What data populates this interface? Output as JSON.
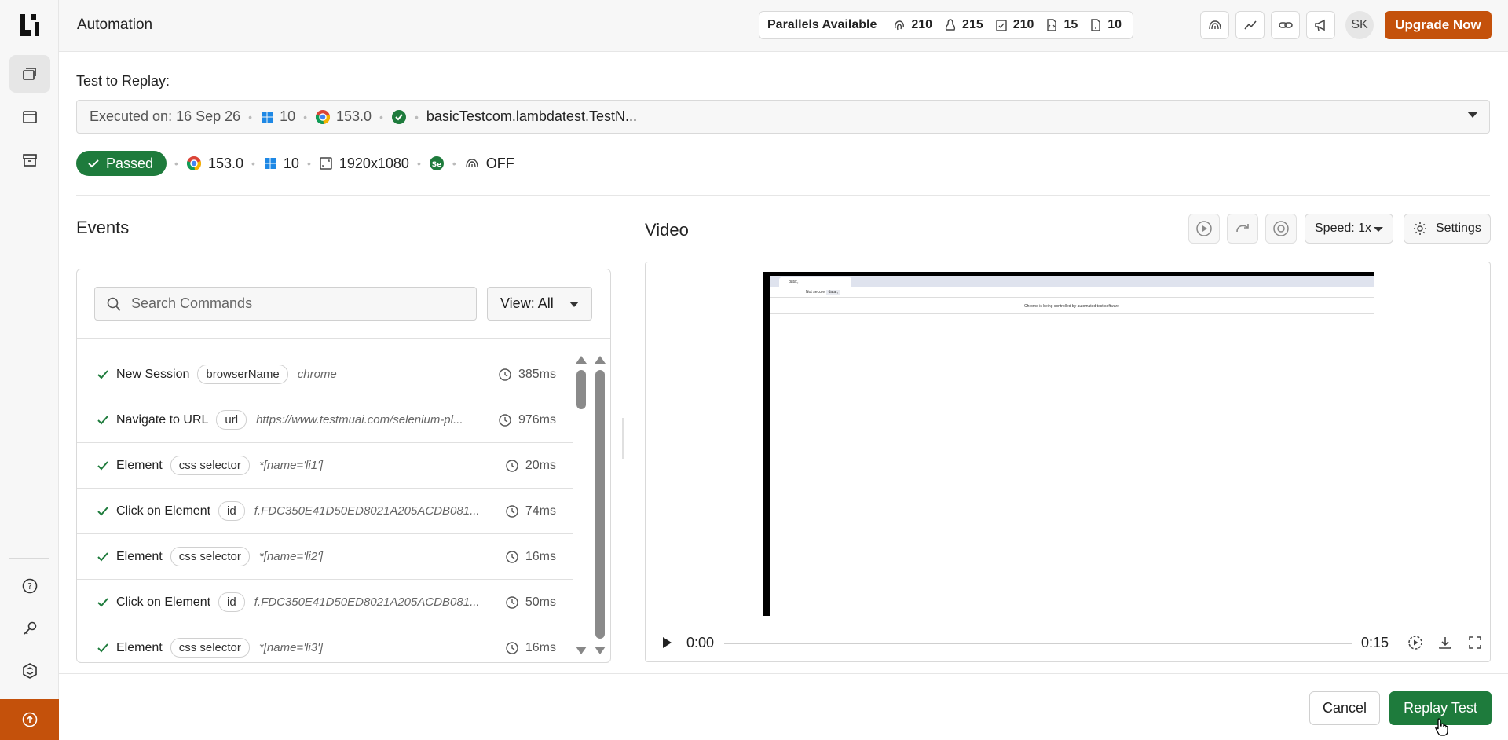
{
  "header": {
    "title": "Automation",
    "parallels_label": "Parallels Available",
    "parallels": [
      {
        "icon": "fingerprint-icon",
        "value": "210"
      },
      {
        "icon": "linux-icon",
        "value": "215"
      },
      {
        "icon": "clipboard-icon",
        "value": "210"
      },
      {
        "icon": "code-file-icon",
        "value": "15"
      },
      {
        "icon": "mobile-file-icon",
        "value": "10"
      }
    ],
    "avatar": "SK",
    "upgrade_label": "Upgrade Now"
  },
  "replay": {
    "label": "Test to Replay:",
    "executed_on": "Executed on: 16 Sep 26",
    "os_version": "10",
    "browser_version": "153.0",
    "test_name": "basicTestcom.lambdatest.TestN..."
  },
  "meta": {
    "status": "Passed",
    "browser_version": "153.0",
    "os_version": "10",
    "resolution": "1920x1080",
    "tunnel": "OFF"
  },
  "events": {
    "title": "Events",
    "search_placeholder": "Search Commands",
    "view_label": "View: All",
    "rows": [
      {
        "cmd": "New Session",
        "tag": "browserName",
        "arg": "chrome",
        "dur": "385ms"
      },
      {
        "cmd": "Navigate to URL",
        "tag": "url",
        "arg": "https://www.testmuai.com/selenium-pl...",
        "dur": "976ms"
      },
      {
        "cmd": "Element",
        "tag": "css selector",
        "arg": "*[name='li1']",
        "dur": "20ms"
      },
      {
        "cmd": "Click on Element",
        "tag": "id",
        "arg": "f.FDC350E41D50ED8021A205ACDB081...",
        "dur": "74ms"
      },
      {
        "cmd": "Element",
        "tag": "css selector",
        "arg": "*[name='li2']",
        "dur": "16ms"
      },
      {
        "cmd": "Click on Element",
        "tag": "id",
        "arg": "f.FDC350E41D50ED8021A205ACDB081...",
        "dur": "50ms"
      },
      {
        "cmd": "Element",
        "tag": "css selector",
        "arg": "*[name='li3']",
        "dur": "16ms"
      }
    ]
  },
  "video": {
    "title": "Video",
    "speed_label": "Speed: 1x",
    "settings_label": "Settings",
    "time_current": "0:00",
    "time_total": "0:15",
    "frame_tab": "data:,",
    "frame_addr_warn": "Not secure",
    "frame_addr": "data:,",
    "frame_info": "Chrome is being controlled by automated test software"
  },
  "footer": {
    "cancel_label": "Cancel",
    "replay_label": "Replay Test"
  },
  "colors": {
    "brand_orange": "#c4510b",
    "success_green": "#1e7b3c"
  }
}
